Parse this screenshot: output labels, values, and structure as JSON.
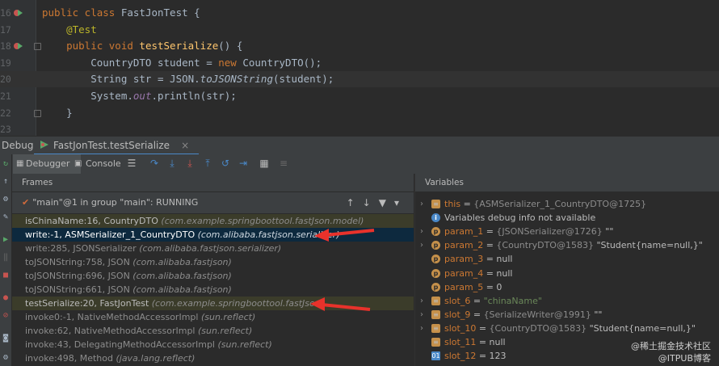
{
  "editor": {
    "lines": [
      {
        "num": "16",
        "tokens": [
          [
            "kw",
            "public class "
          ],
          [
            "",
            "FastJonTest {"
          ]
        ]
      },
      {
        "num": "17",
        "tokens": [
          [
            "ann",
            "    @Test"
          ]
        ]
      },
      {
        "num": "18",
        "tokens": [
          [
            "kw",
            "    public void "
          ],
          [
            "fn",
            "testSerialize"
          ],
          [
            "",
            "() {"
          ]
        ]
      },
      {
        "num": "19",
        "tokens": [
          [
            "",
            "        CountryDTO student = "
          ],
          [
            "kw",
            "new "
          ],
          [
            "",
            "CountryDTO();"
          ]
        ]
      },
      {
        "num": "20",
        "tokens": [
          [
            "",
            "        String str = JSON."
          ],
          [
            "it",
            "toJSONString"
          ],
          [
            "",
            "(student);"
          ]
        ]
      },
      {
        "num": "21",
        "tokens": [
          [
            "",
            "        System."
          ],
          [
            "st",
            "out"
          ],
          [
            "",
            ".println(str);"
          ]
        ]
      },
      {
        "num": "22",
        "tokens": [
          [
            "",
            "    }"
          ]
        ]
      },
      {
        "num": "23",
        "tokens": [
          [
            "",
            ""
          ]
        ]
      }
    ]
  },
  "debug": {
    "label": "Debug:",
    "session_tab": "FastJonTest.testSerialize",
    "close": "×",
    "tabs": {
      "debugger": "Debugger",
      "console": "Console"
    }
  },
  "frames": {
    "header": "Frames",
    "thread": "\"main\"@1 in group \"main\": RUNNING",
    "rows": [
      {
        "method": "isChinaName:16, CountryDTO",
        "pkg": "(com.example.springboottool.fastJson.model)",
        "style": "hl"
      },
      {
        "method": "write:-1, ASMSerializer_1_CountryDTO",
        "pkg": "(com.alibaba.fastjson.serializer)",
        "style": "sel"
      },
      {
        "method": "write:285, JSONSerializer",
        "pkg": "(com.alibaba.fastjson.serializer)",
        "style": "lib"
      },
      {
        "method": "toJSONString:758, JSON",
        "pkg": "(com.alibaba.fastjson)",
        "style": "lib"
      },
      {
        "method": "toJSONString:696, JSON",
        "pkg": "(com.alibaba.fastjson)",
        "style": "lib"
      },
      {
        "method": "toJSONString:661, JSON",
        "pkg": "(com.alibaba.fastjson)",
        "style": "lib"
      },
      {
        "method": "testSerialize:20, FastJonTest",
        "pkg": "(com.example.springboottool.fastJson)",
        "style": "hl"
      },
      {
        "method": "invoke0:-1, NativeMethodAccessorImpl",
        "pkg": "(sun.reflect)",
        "style": "lib"
      },
      {
        "method": "invoke:62, NativeMethodAccessorImpl",
        "pkg": "(sun.reflect)",
        "style": "lib"
      },
      {
        "method": "invoke:43, DelegatingMethodAccessorImpl",
        "pkg": "(sun.reflect)",
        "style": "lib"
      },
      {
        "method": "invoke:498, Method",
        "pkg": "(java.lang.reflect)",
        "style": "lib"
      }
    ]
  },
  "variables": {
    "header": "Variables",
    "rows": [
      {
        "arrow": "›",
        "icon": "field",
        "name": "this",
        "eq": " = ",
        "ref": "{ASMSerializer_1_CountryDTO@1725}",
        "val": ""
      },
      {
        "arrow": "",
        "icon": "info",
        "name": "Variables debug info not available",
        "eq": "",
        "ref": "",
        "val": ""
      },
      {
        "arrow": "›",
        "icon": "param",
        "name": "param_1",
        "eq": " = ",
        "ref": "{JSONSerializer@1726}",
        "val": " \"\""
      },
      {
        "arrow": "›",
        "icon": "param",
        "name": "param_2",
        "eq": " = ",
        "ref": "{CountryDTO@1583}",
        "val": " \"Student{name=null,}\""
      },
      {
        "arrow": "",
        "icon": "param",
        "name": "param_3",
        "eq": " = ",
        "ref": "",
        "val": "null"
      },
      {
        "arrow": "",
        "icon": "param",
        "name": "param_4",
        "eq": " = ",
        "ref": "",
        "val": "null"
      },
      {
        "arrow": "",
        "icon": "param",
        "name": "param_5",
        "eq": " = ",
        "ref": "",
        "val": "0"
      },
      {
        "arrow": "›",
        "icon": "field",
        "name": "slot_6",
        "eq": " = ",
        "ref": "",
        "val": "\"chinaName\""
      },
      {
        "arrow": "›",
        "icon": "field",
        "name": "slot_9",
        "eq": " = ",
        "ref": "{SerializeWriter@1991}",
        "val": " \"\""
      },
      {
        "arrow": "›",
        "icon": "field",
        "name": "slot_10",
        "eq": " = ",
        "ref": "{CountryDTO@1583}",
        "val": " \"Student{name=null,}\""
      },
      {
        "arrow": "",
        "icon": "field",
        "name": "slot_11",
        "eq": " = ",
        "ref": "",
        "val": "null"
      },
      {
        "arrow": "",
        "icon": "num",
        "name": "slot_12",
        "eq": " = ",
        "ref": "",
        "val": "123"
      }
    ]
  },
  "watermarks": {
    "top": "@稀土掘金技术社区",
    "bottom": "@ITPUB博客"
  },
  "colors": {
    "arrow_red": "#e8322b",
    "selection": "#0d293e",
    "accent": "#4a88c7"
  }
}
